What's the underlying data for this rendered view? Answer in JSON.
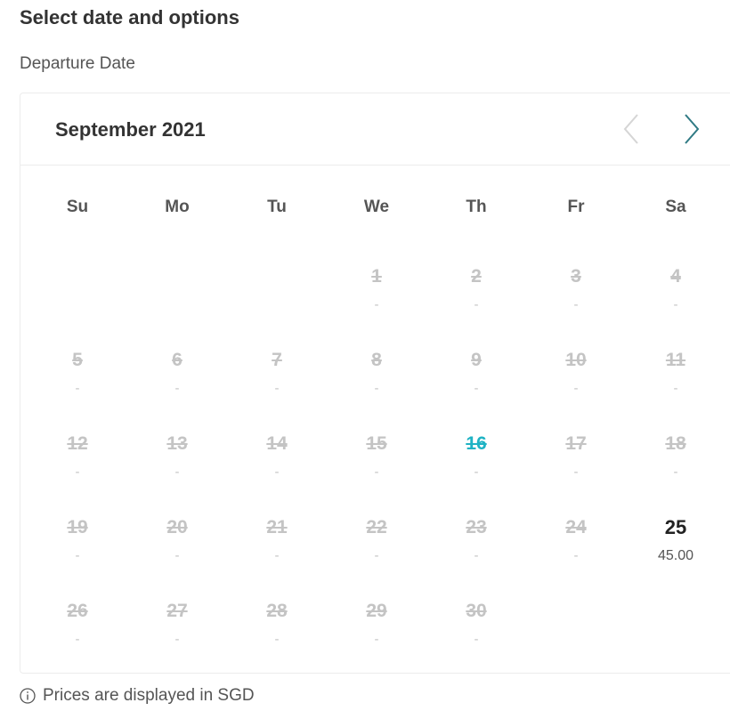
{
  "page": {
    "title": "Select date and options",
    "field_label": "Departure Date"
  },
  "calendar": {
    "month_label": "September 2021",
    "prev_icon": "chevron-left-icon",
    "next_icon": "chevron-right-icon",
    "weekdays": [
      "Su",
      "Mo",
      "Tu",
      "We",
      "Th",
      "Fr",
      "Sa"
    ],
    "first_weekday_index": 3,
    "days": [
      {
        "day": "1",
        "price": "-",
        "status": "unavailable"
      },
      {
        "day": "2",
        "price": "-",
        "status": "unavailable"
      },
      {
        "day": "3",
        "price": "-",
        "status": "unavailable"
      },
      {
        "day": "4",
        "price": "-",
        "status": "unavailable"
      },
      {
        "day": "5",
        "price": "-",
        "status": "unavailable"
      },
      {
        "day": "6",
        "price": "-",
        "status": "unavailable"
      },
      {
        "day": "7",
        "price": "-",
        "status": "unavailable"
      },
      {
        "day": "8",
        "price": "-",
        "status": "unavailable"
      },
      {
        "day": "9",
        "price": "-",
        "status": "unavailable"
      },
      {
        "day": "10",
        "price": "-",
        "status": "unavailable"
      },
      {
        "day": "11",
        "price": "-",
        "status": "unavailable"
      },
      {
        "day": "12",
        "price": "-",
        "status": "unavailable"
      },
      {
        "day": "13",
        "price": "-",
        "status": "unavailable"
      },
      {
        "day": "14",
        "price": "-",
        "status": "unavailable"
      },
      {
        "day": "15",
        "price": "-",
        "status": "unavailable"
      },
      {
        "day": "16",
        "price": "-",
        "status": "today"
      },
      {
        "day": "17",
        "price": "-",
        "status": "unavailable"
      },
      {
        "day": "18",
        "price": "-",
        "status": "unavailable"
      },
      {
        "day": "19",
        "price": "-",
        "status": "unavailable"
      },
      {
        "day": "20",
        "price": "-",
        "status": "unavailable"
      },
      {
        "day": "21",
        "price": "-",
        "status": "unavailable"
      },
      {
        "day": "22",
        "price": "-",
        "status": "unavailable"
      },
      {
        "day": "23",
        "price": "-",
        "status": "unavailable"
      },
      {
        "day": "24",
        "price": "-",
        "status": "unavailable"
      },
      {
        "day": "25",
        "price": "45.00",
        "status": "available"
      },
      {
        "day": "26",
        "price": "-",
        "status": "unavailable"
      },
      {
        "day": "27",
        "price": "-",
        "status": "unavailable"
      },
      {
        "day": "28",
        "price": "-",
        "status": "unavailable"
      },
      {
        "day": "29",
        "price": "-",
        "status": "unavailable"
      },
      {
        "day": "30",
        "price": "-",
        "status": "unavailable"
      }
    ]
  },
  "footnote": {
    "icon": "info-circle-icon",
    "text": "Prices are displayed in SGD"
  },
  "colors": {
    "today_accent": "#1fb3c4",
    "nav_active": "#2f7a84",
    "nav_disabled": "#d5d5d5",
    "unavailable_text": "#c4c4c4"
  }
}
